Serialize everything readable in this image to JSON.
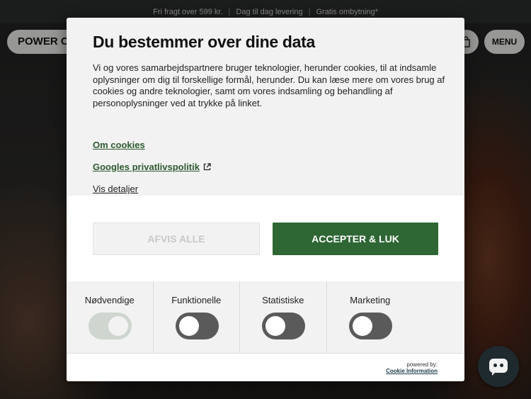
{
  "topbar": {
    "items": [
      "Fri fragt over 599 kr.",
      "Dag til dag levering",
      "Gratis ombytning*"
    ],
    "separator": "|"
  },
  "header": {
    "logo_text": "POWER CU",
    "menu_label": "MENU",
    "cart_icon": "bag-icon"
  },
  "modal": {
    "title": "Du bestemmer over dine data",
    "description": "Vi og vores samarbejdspartnere bruger teknologier, herunder cookies, til at indsamle oplysninger om dig til forskellige formål, herunder. Du kan læse mere om vores brug af cookies og andre teknologier, samt om vores indsamling og behandling af personoplysninger ved at trykke på linket.",
    "links": {
      "about_cookies": "Om cookies",
      "google_privacy": "Googles privatlivspolitik",
      "show_details": "Vis detaljer"
    },
    "buttons": {
      "reject": "AFVIS ALLE",
      "accept": "ACCEPTER & LUK"
    },
    "categories": [
      {
        "label": "Nødvendige",
        "enabled": true,
        "locked": true
      },
      {
        "label": "Funktionelle",
        "enabled": false
      },
      {
        "label": "Statistiske",
        "enabled": false
      },
      {
        "label": "Marketing",
        "enabled": false
      }
    ],
    "footer": {
      "powered_by": "powered by:",
      "brand": "Cookie Information"
    }
  },
  "colors": {
    "accent_green": "#2e6634",
    "link_green": "#2d5a2f",
    "toggle_off": "#5a5a5a",
    "topbar_bg": "#2a2c2b"
  },
  "chat": {
    "icon": "chat-bubble-icon"
  }
}
